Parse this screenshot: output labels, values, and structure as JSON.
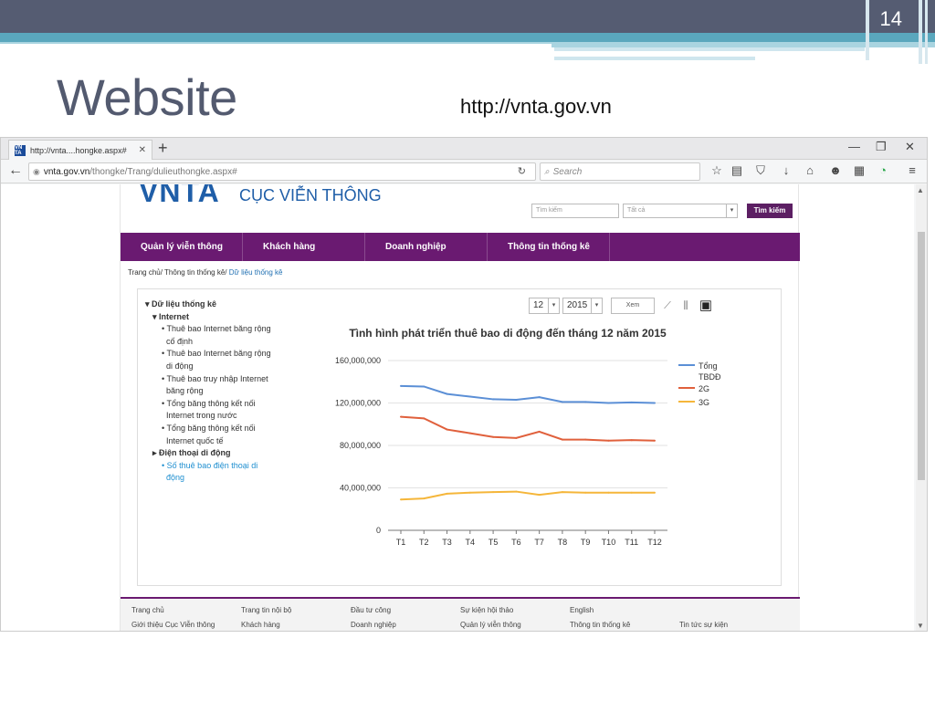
{
  "slide": {
    "number": "14",
    "title": "Website",
    "url": "http://vnta.gov.vn"
  },
  "browser": {
    "tab_title": "http://vnta....hongke.aspx#",
    "tab_favicon": "VN TA",
    "url_host": "vnta.gov.vn",
    "url_path": "/thongke/Trang/dulieuthongke.aspx#",
    "search_placeholder": "Search"
  },
  "site": {
    "logo": "VNTA",
    "org_name": "CỤC VIỄN THÔNG",
    "search_placeholder": "Tìm kiếm",
    "filter_value": "Tất cả",
    "search_button": "Tìm kiếm",
    "nav": [
      "Quản lý viễn thông",
      "Khách hàng",
      "Doanh nghiệp",
      "Thông tin thống kê"
    ],
    "breadcrumb": {
      "home": "Trang chủ/",
      "section": " Thông tin thống kê/",
      "current": " Dữ liệu thống kê"
    },
    "tree": {
      "root": "Dữ liệu thống kê",
      "internet": "Internet",
      "internet_items": [
        [
          "Thuê bao Internet băng rộng",
          "cố định"
        ],
        [
          "Thuê bao Internet băng rộng",
          "di động"
        ],
        [
          "Thuê bao truy nhập Internet",
          "băng rộng"
        ],
        [
          "Tổng băng thông kết nối",
          "Internet trong nước"
        ],
        [
          "Tổng băng thông kết nối",
          "Internet quốc tế"
        ]
      ],
      "mobile": "Điện thoại di động",
      "mobile_item": [
        "Số thuê bao điện thoại di",
        "động"
      ]
    },
    "controls": {
      "month": "12",
      "year": "2015",
      "view_button": "Xem"
    },
    "footer": {
      "row1": [
        "Trang chủ",
        "Trang tin nội bộ",
        "Đầu tư công",
        "Sự kiện hội thảo",
        "English"
      ],
      "row2": [
        "Giới thiệu Cục Viễn thông",
        "Khách hàng",
        "Doanh nghiệp",
        "Quản lý viễn thông",
        "Thông tin thống kê",
        "Tin tức sự kiện"
      ]
    }
  },
  "chart_data": {
    "type": "line",
    "title": "Tình hình phát triển thuê bao di động đến tháng 12 năm 2015",
    "categories": [
      "T1",
      "T2",
      "T3",
      "T4",
      "T5",
      "T6",
      "T7",
      "T8",
      "T9",
      "T10",
      "T11",
      "T12"
    ],
    "ylim": [
      0,
      160000000
    ],
    "yticks": [
      0,
      40000000,
      80000000,
      120000000,
      160000000
    ],
    "ytick_labels": [
      "0",
      "40,000,000",
      "80,000,000",
      "120,000,000",
      "160,000,000"
    ],
    "grid": true,
    "legend_position": "right",
    "series": [
      {
        "name": "Tổng TBDĐ",
        "color": "#5b8fd6",
        "values": [
          136000000,
          135500000,
          128500000,
          126000000,
          123500000,
          123000000,
          125500000,
          121000000,
          121000000,
          120000000,
          120500000,
          120000000
        ]
      },
      {
        "name": "2G",
        "color": "#e0603c",
        "values": [
          107000000,
          105500000,
          95000000,
          91500000,
          88000000,
          87000000,
          93000000,
          85500000,
          85500000,
          84500000,
          85000000,
          84500000
        ]
      },
      {
        "name": "3G",
        "color": "#f5b63a",
        "values": [
          29000000,
          30000000,
          34500000,
          35500000,
          36000000,
          36500000,
          33500000,
          36000000,
          35500000,
          35500000,
          35500000,
          35500000
        ]
      }
    ]
  }
}
